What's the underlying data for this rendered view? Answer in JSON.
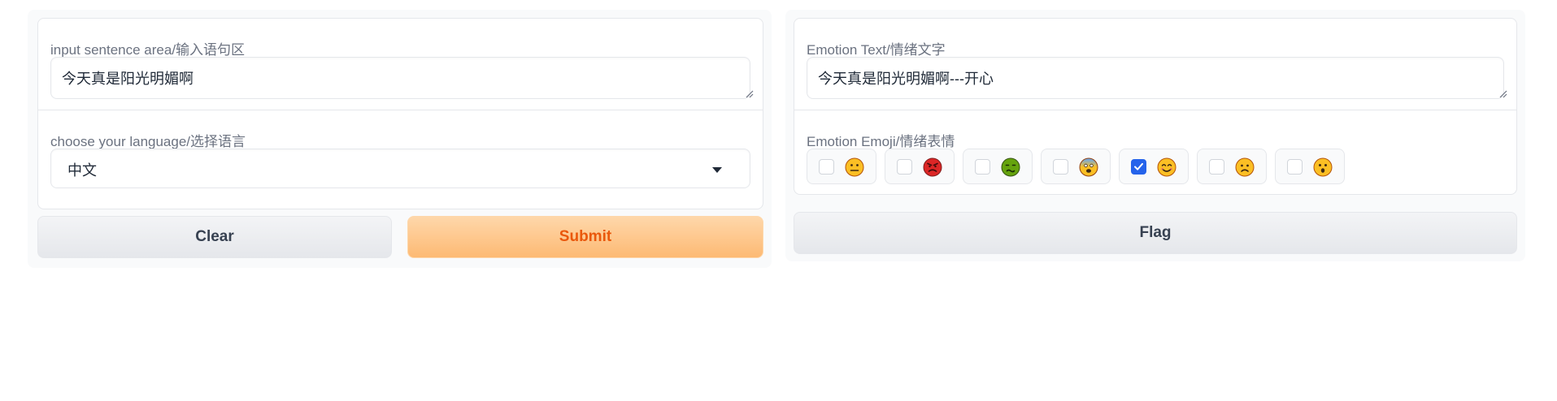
{
  "left": {
    "input_label": "input sentence area/输入语句区",
    "input_value": "今天真是阳光明媚啊",
    "language_label": "choose your language/选择语言",
    "language_value": "中文",
    "clear_label": "Clear",
    "submit_label": "Submit"
  },
  "right": {
    "emotion_text_label": "Emotion Text/情绪文字",
    "emotion_text_value": "今天真是阳光明媚啊---开心",
    "emotion_emoji_label": "Emotion Emoji/情绪表情",
    "flag_label": "Flag",
    "emojis": [
      {
        "icon": "neutral-face-icon",
        "checked": false
      },
      {
        "icon": "angry-face-icon",
        "checked": false
      },
      {
        "icon": "nauseated-face-icon",
        "checked": false
      },
      {
        "icon": "fearful-face-icon",
        "checked": false
      },
      {
        "icon": "smiling-face-icon",
        "checked": true
      },
      {
        "icon": "worried-face-icon",
        "checked": false
      },
      {
        "icon": "astonished-face-icon",
        "checked": false
      }
    ]
  },
  "colors": {
    "accent_blue": "#2563eb",
    "submit_orange": "#ea580c",
    "emoji_yellow": "#fbbf24",
    "emoji_red": "#dc2626",
    "emoji_green": "#65a30d"
  }
}
